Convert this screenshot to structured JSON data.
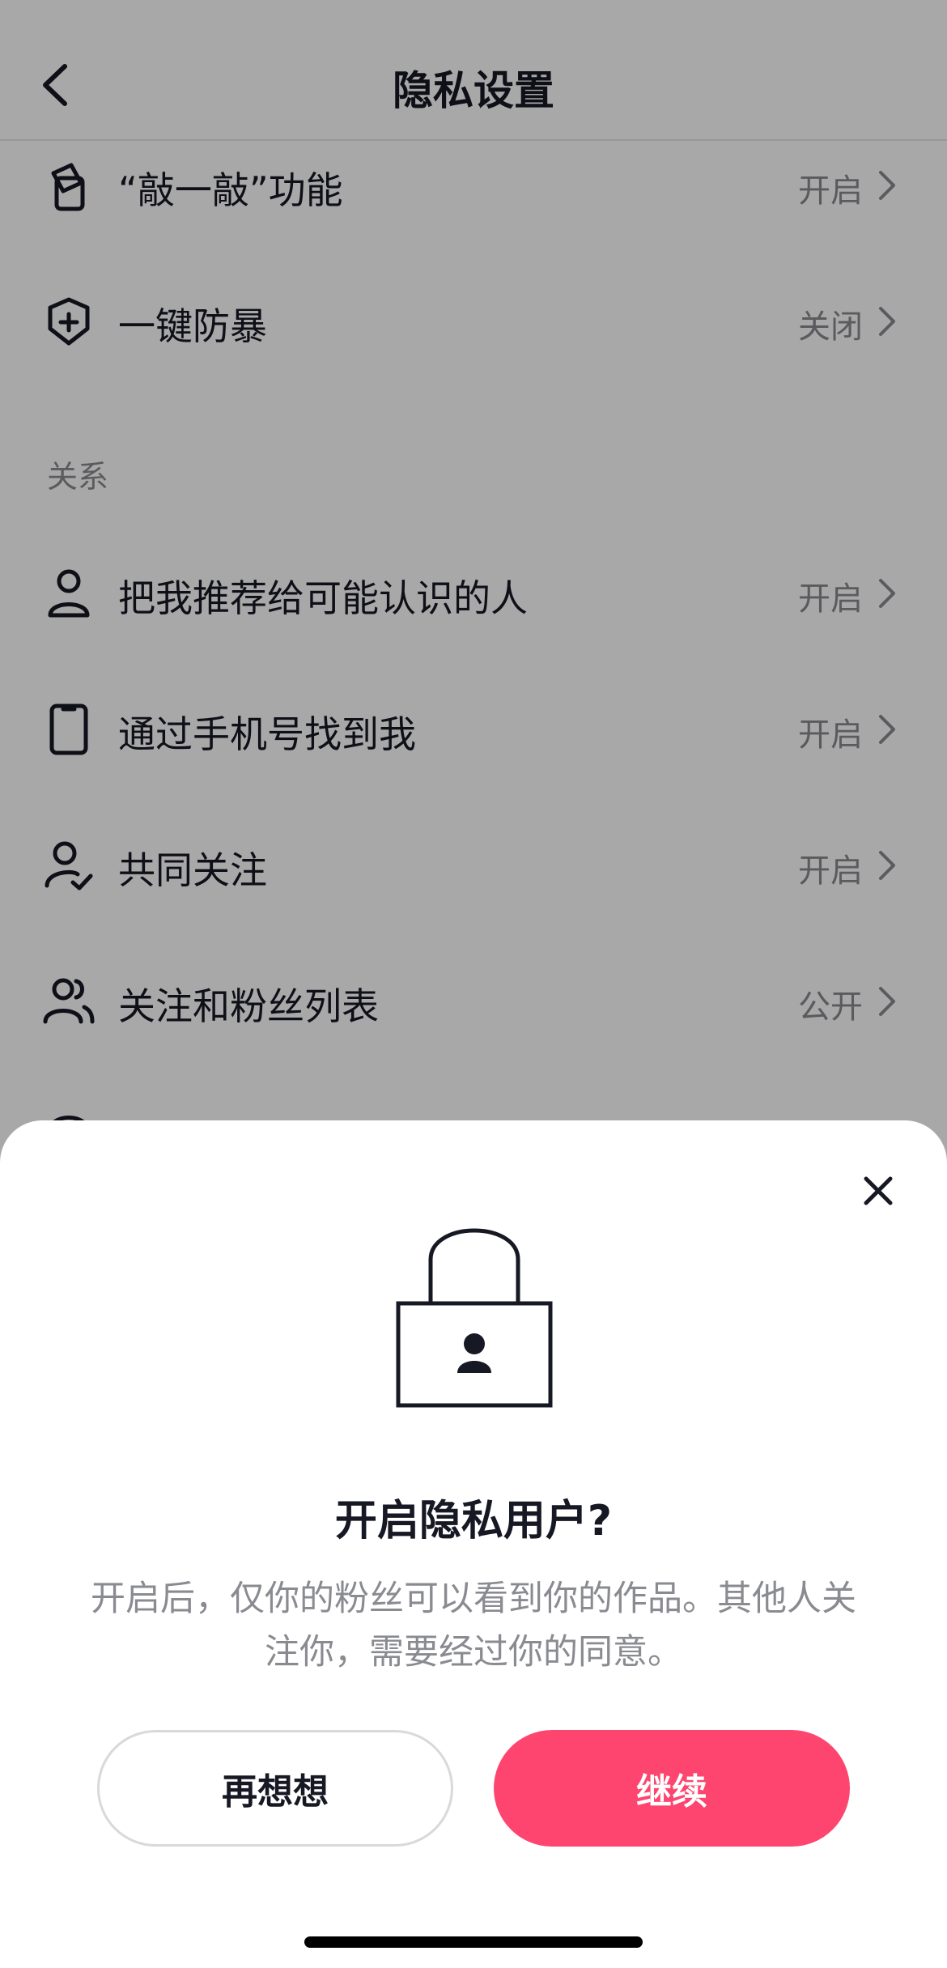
{
  "header": {
    "title": "隐私设置"
  },
  "settings": [
    {
      "label": "“敲一敲”功能",
      "value": "开启",
      "icon": "phone-tap-icon"
    },
    {
      "label": "一键防暴",
      "value": "关闭",
      "icon": "shield-plus-icon"
    }
  ],
  "relations": {
    "section_title": "关系",
    "items": [
      {
        "label": "把我推荐给可能认识的人",
        "value": "开启",
        "icon": "user-icon"
      },
      {
        "label": "通过手机号找到我",
        "value": "开启",
        "icon": "phone-icon"
      },
      {
        "label": "共同关注",
        "value": "开启",
        "icon": "user-check-icon"
      },
      {
        "label": "关注和粉丝列表",
        "value": "公开",
        "icon": "users-icon"
      }
    ]
  },
  "dialog": {
    "title": "开启隐私用户?",
    "description": "开启后，仅你的粉丝可以看到你的作品。其他人关注你，需要经过你的同意。",
    "cancel_label": "再想想",
    "continue_label": "继续",
    "icon": "lock-user-icon",
    "close_icon": "close-icon"
  },
  "colors": {
    "accent": "#FD4570",
    "text": "#161823",
    "muted": "#8A8B91"
  }
}
